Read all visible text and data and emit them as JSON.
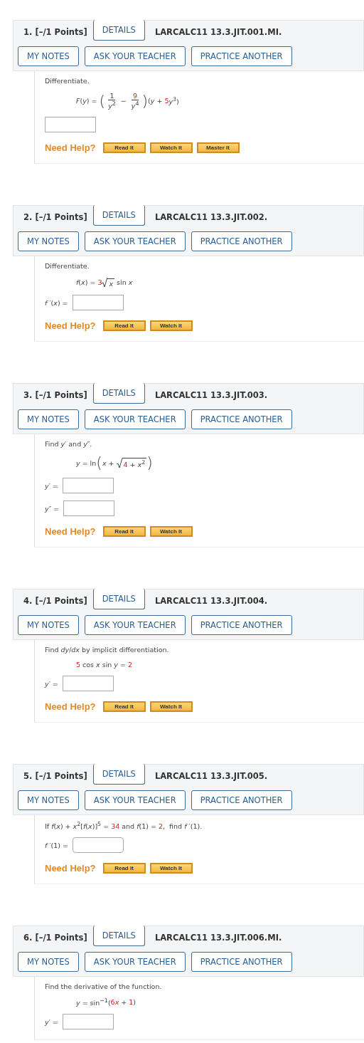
{
  "problems": [
    {
      "number": "1.",
      "points": "[–/1 Points]",
      "details": "DETAILS",
      "code": "LARCALC11 13.3.JIT.001.MI.",
      "buttons": [
        "MY NOTES",
        "ASK YOUR TEACHER",
        "PRACTICE ANOTHER"
      ],
      "prompt": [
        {
          "text": "Differentiate.",
          "given": false
        }
      ],
      "formula": [
        {
          "kind": "text",
          "text": "*F*(*y*) = ",
          "given": false
        },
        {
          "kind": "big",
          "text": "("
        },
        {
          "kind": "frac",
          "num": "1",
          "den": "*y*$^{2}$",
          "given": false
        },
        {
          "kind": "text",
          "text": " − ",
          "given": false
        },
        {
          "kind": "frac",
          "num": "9",
          "den": "*y*$^{4}$",
          "given": true
        },
        {
          "kind": "big",
          "text": ")"
        },
        {
          "kind": "text",
          "text": "(*y* + ",
          "given": false
        },
        {
          "kind": "text",
          "text": "5",
          "given": true
        },
        {
          "kind": "text",
          "text": "*y*$^{3}$)",
          "given": false
        }
      ],
      "answers": [
        {
          "kind": "bare"
        }
      ],
      "need_help": "Need Help?",
      "help_buttons": [
        "Read It",
        "Watch It",
        "Master It"
      ]
    },
    {
      "number": "2.",
      "points": "[–/1 Points]",
      "details": "DETAILS",
      "code": "LARCALC11 13.3.JIT.002.",
      "buttons": [
        "MY NOTES",
        "ASK YOUR TEACHER",
        "PRACTICE ANOTHER"
      ],
      "prompt": [
        {
          "text": "Differentiate.",
          "given": false
        }
      ],
      "formula": [
        {
          "kind": "text",
          "text": "*f*(*x*) = ",
          "given": false
        },
        {
          "kind": "text",
          "text": "3",
          "given": true
        },
        {
          "kind": "sqrt",
          "parts": [
            {
              "kind": "text",
              "text": "*x*",
              "given": false
            }
          ]
        },
        {
          "kind": "text",
          "text": " sin *x*",
          "given": false
        }
      ],
      "answers": [
        {
          "kind": "labeled",
          "label": "*f* ′(*x*) ="
        }
      ],
      "need_help": "Need Help?",
      "help_buttons": [
        "Read It",
        "Watch It"
      ]
    },
    {
      "number": "3.",
      "points": "[–/1 Points]",
      "details": "DETAILS",
      "code": "LARCALC11 13.3.JIT.003.",
      "buttons": [
        "MY NOTES",
        "ASK YOUR TEACHER",
        "PRACTICE ANOTHER"
      ],
      "prompt": [
        {
          "text": "Find *y*′ and *y*″.",
          "given": false
        }
      ],
      "formula": [
        {
          "kind": "text",
          "text": "*y* = ln",
          "given": false
        },
        {
          "kind": "big",
          "text": "("
        },
        {
          "kind": "text",
          "text": "*x* + ",
          "given": false
        },
        {
          "kind": "sqrt",
          "parts": [
            {
              "kind": "text",
              "text": "4",
              "given": true
            },
            {
              "kind": "text",
              "text": " + *x*$^{2}$",
              "given": false
            }
          ]
        },
        {
          "kind": "big",
          "text": ")"
        }
      ],
      "answers": [
        {
          "kind": "labeled",
          "label": "*y*′ ="
        },
        {
          "kind": "labeled",
          "label": "*y*″ ="
        }
      ],
      "need_help": "Need Help?",
      "help_buttons": [
        "Read It",
        "Watch It"
      ]
    },
    {
      "number": "4.",
      "points": "[–/1 Points]",
      "details": "DETAILS",
      "code": "LARCALC11 13.3.JIT.004.",
      "buttons": [
        "MY NOTES",
        "ASK YOUR TEACHER",
        "PRACTICE ANOTHER"
      ],
      "prompt": [
        {
          "text": "Find *dy*/*dx* by implicit differentiation.",
          "given": false
        }
      ],
      "formula": [
        {
          "kind": "text",
          "text": "5",
          "given": true
        },
        {
          "kind": "text",
          "text": " cos *x* sin *y* = ",
          "given": false
        },
        {
          "kind": "text",
          "text": "2",
          "given": true
        }
      ],
      "answers": [
        {
          "kind": "labeled",
          "label": "*y*′ ="
        }
      ],
      "need_help": "Need Help?",
      "help_buttons": [
        "Read It",
        "Watch It"
      ]
    },
    {
      "number": "5.",
      "points": "[–/1 Points]",
      "details": "DETAILS",
      "code": "LARCALC11 13.3.JIT.005.",
      "buttons": [
        "MY NOTES",
        "ASK YOUR TEACHER",
        "PRACTICE ANOTHER"
      ],
      "prompt": [
        {
          "text": "If *f*(*x*) + *x*$^{2}$[*f*(*x*)]$^{5}$ = ",
          "given": false
        },
        {
          "text": "34",
          "given": true
        },
        {
          "text": " and *f*(1) = ",
          "given": false
        },
        {
          "text": "2",
          "given": true
        },
        {
          "text": ",  find *f* ′(1).",
          "given": false
        }
      ],
      "answers": [
        {
          "kind": "labeled",
          "label": "*f* ′(1) ="
        }
      ],
      "need_help": "Need Help?",
      "help_buttons": [
        "Read It",
        "Watch It"
      ]
    },
    {
      "number": "6.",
      "points": "[–/1 Points]",
      "details": "DETAILS",
      "code": "LARCALC11 13.3.JIT.006.MI.",
      "buttons": [
        "MY NOTES",
        "ASK YOUR TEACHER",
        "PRACTICE ANOTHER"
      ],
      "prompt": [
        {
          "text": "Find the derivative of the function.",
          "given": false
        }
      ],
      "formula": [
        {
          "kind": "text",
          "text": "*y* = sin$^{−1}$(",
          "given": false
        },
        {
          "kind": "text",
          "text": "6",
          "given": true
        },
        {
          "kind": "text",
          "text": "*x*",
          "given": true
        },
        {
          "kind": "text",
          "text": " + ",
          "given": false
        },
        {
          "kind": "text",
          "text": "1",
          "given": true
        },
        {
          "kind": "text",
          "text": ")",
          "given": false
        }
      ],
      "answers": [
        {
          "kind": "labeled",
          "label": "*y*′ ="
        }
      ]
    }
  ]
}
